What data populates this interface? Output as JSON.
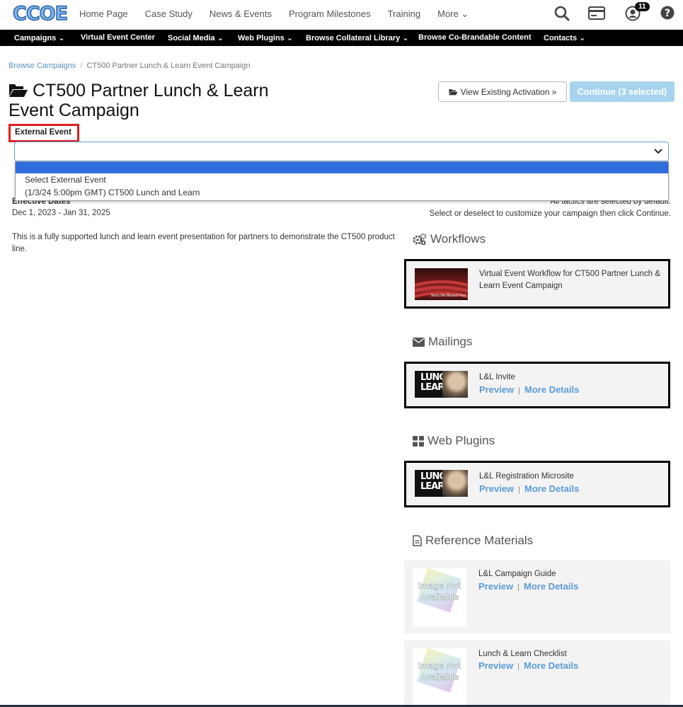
{
  "logo": {
    "text": "CCOE"
  },
  "top_nav": {
    "links": [
      "Home Page",
      "Case Study",
      "News & Events",
      "Program Milestones",
      "Training",
      "More"
    ],
    "notification_count": "11"
  },
  "sub_nav": {
    "items": [
      "Campaigns",
      "Virtual Event Center",
      "Social Media",
      "Web Plugins",
      "Browse Collateral Library",
      "Browse Co-Brandable Content",
      "Contacts"
    ]
  },
  "breadcrumb": {
    "root": "Browse Campaigns",
    "current": "CT500 Partner Lunch & Learn Event Campaign"
  },
  "page": {
    "title": "CT500 Partner Lunch & Learn Event Campaign",
    "view_button": "View Existing Activation »",
    "continue_button": "Continue (3 selected)"
  },
  "external_event": {
    "label": "External Event",
    "options": [
      "Select External Event",
      "(1/3/24 5:00pm GMT) CT500 Lunch and Learn"
    ]
  },
  "details": {
    "effective_label": "Effective Dates",
    "effective_dates": "Dec 1, 2023 - Jan 31, 2025",
    "description": "This is a fully supported lunch and learn event presentation for partners to demonstrate the CT500 product line.",
    "tactics_note_1": "All tactics are selected by default.",
    "tactics_note_2": "Select or deselect to customize your campaign then click Continue."
  },
  "sections": {
    "workflows": {
      "heading": "Workflows",
      "items": [
        {
          "title": "Virtual Event Workflow for CT500 Partner Lunch & Learn Event Campaign",
          "thumb_caption": "Sorry We Missed You!"
        }
      ]
    },
    "mailings": {
      "heading": "Mailings",
      "items": [
        {
          "title": "L&L Invite"
        }
      ]
    },
    "web_plugins": {
      "heading": "Web Plugins",
      "items": [
        {
          "title": "L&L Registration Microsite"
        }
      ]
    },
    "reference": {
      "heading": "Reference Materials",
      "items": [
        {
          "title": "L&L Campaign Guide"
        },
        {
          "title": "Lunch & Learn Checklist"
        }
      ]
    }
  },
  "links": {
    "preview": "Preview",
    "more_details": "More Details"
  },
  "thumbs": {
    "lunch_line1": "LUNCH",
    "lunch_line2": "LEARN",
    "na_text": "Image Not Available"
  }
}
